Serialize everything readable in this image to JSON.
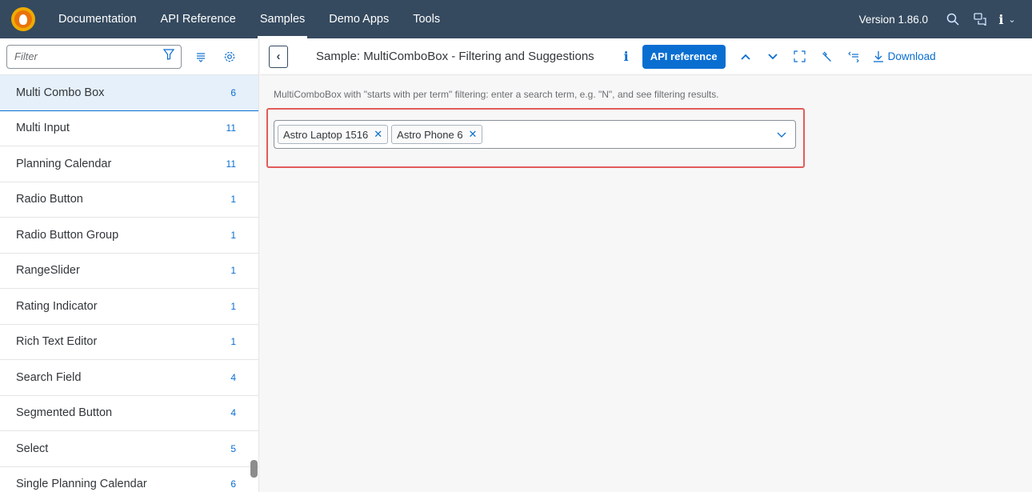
{
  "shell": {
    "nav": [
      "Documentation",
      "API Reference",
      "Samples",
      "Demo Apps",
      "Tools"
    ],
    "active_nav": "Samples",
    "version": "Version 1.86.0",
    "icons": [
      "search-icon",
      "feedback-icon",
      "info-icon",
      "chevron-down-icon"
    ]
  },
  "sidebar": {
    "filter_placeholder": "Filter",
    "items": [
      {
        "label": "Multi Combo Box",
        "count": "6"
      },
      {
        "label": "Multi Input",
        "count": "11"
      },
      {
        "label": "Planning Calendar",
        "count": "11"
      },
      {
        "label": "Radio Button",
        "count": "1"
      },
      {
        "label": "Radio Button Group",
        "count": "1"
      },
      {
        "label": "RangeSlider",
        "count": "1"
      },
      {
        "label": "Rating Indicator",
        "count": "1"
      },
      {
        "label": "Rich Text Editor",
        "count": "1"
      },
      {
        "label": "Search Field",
        "count": "4"
      },
      {
        "label": "Segmented Button",
        "count": "4"
      },
      {
        "label": "Select",
        "count": "5"
      },
      {
        "label": "Single Planning Calendar",
        "count": "6"
      }
    ]
  },
  "sample": {
    "title": "Sample: MultiComboBox - Filtering and Suggestions",
    "api_button": "API reference",
    "download": "Download",
    "description": "MultiComboBox with \"starts with per term\" filtering: enter a search term, e.g. \"N\", and see filtering results.",
    "tokens": [
      "Astro Laptop 1516",
      "Astro Phone 6"
    ]
  },
  "colors": {
    "shell": "#354a5f",
    "accent": "#0a6ed1",
    "selected_row": "#e5f0fa",
    "highlight_border": "#e35b5b"
  }
}
